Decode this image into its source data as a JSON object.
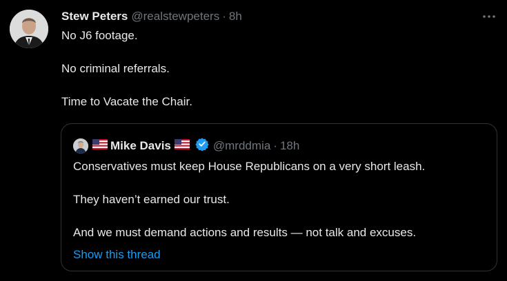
{
  "tweet": {
    "author_name": "Stew Peters",
    "handle": "@realstewpeters",
    "separator": "·",
    "time": "8h",
    "more_icon": "more-horizontal-icon",
    "lines": [
      "No J6 footage.",
      "No criminal referrals.",
      "Time to Vacate the Chair."
    ]
  },
  "quote": {
    "author_name": "Mike Davis",
    "handle": "@mrddmia",
    "separator": "·",
    "time": "18h",
    "flag_icon": "us-flag-icon",
    "verified_icon": "verified-badge-icon",
    "lines": [
      "Conservatives must keep House Republicans on a very short leash.",
      "They haven’t earned our trust.",
      "And we must demand actions and results — not talk and excuses."
    ],
    "show_thread": "Show this thread"
  },
  "colors": {
    "background": "#000000",
    "text": "#e7e9ea",
    "secondary": "#71767b",
    "link": "#1d9bf0",
    "border": "#2f3336",
    "verified": "#1d9bf0"
  }
}
